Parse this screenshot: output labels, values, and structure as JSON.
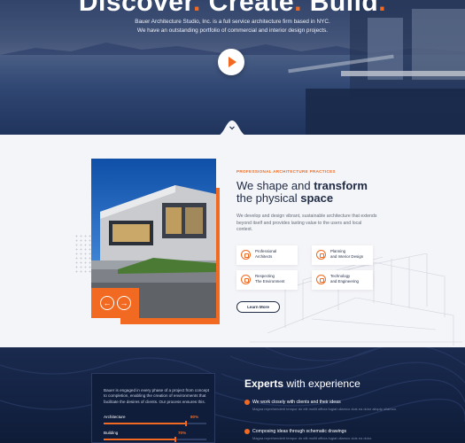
{
  "hero": {
    "title_part1": "Discover",
    "title_part2": "Create",
    "title_part3": "Build",
    "dot": ".",
    "subtitle_line1": "Bauer Architecture Studio, Inc. is a full service architecture firm based in NYC.",
    "subtitle_line2": "We have an outstanding portfolio of commercial and interior design projects.",
    "play_icon": "play-icon",
    "scroll_icon": "chevron-down-icon"
  },
  "about": {
    "eyebrow": "PROFESSIONAL ARCHITECTURE PRACTICES",
    "headline_1": "We shape and ",
    "headline_2": "transform",
    "headline_3": "the physical ",
    "headline_4": "space",
    "body": "We develop and design vibrant, sustainable architecture that extends beyond itself and provides lasting value to the users and local context.",
    "features": [
      {
        "line1": "Professional",
        "line2": "Architects",
        "icon": "architect-icon"
      },
      {
        "line1": "Planning",
        "line2": "and Interior Design",
        "icon": "planning-icon"
      },
      {
        "line1": "Respecting",
        "line2": "The Environment",
        "icon": "leaf-icon"
      },
      {
        "line1": "Technology",
        "line2": "and Engineering",
        "icon": "gear-icon"
      }
    ],
    "learn_more": "Learn More",
    "prev_arrow": "←",
    "next_arrow": "→"
  },
  "experience": {
    "card_text": "Bauer is engaged in every phase of a project from concept to completion, enabling the creation of environments that facilitate the desires of clients. Our process ensures this.",
    "bars": [
      {
        "label": "Architecture",
        "percent": "80%",
        "value": 0.8
      },
      {
        "label": "Building",
        "percent": "70%",
        "value": 0.7
      }
    ],
    "title_1": "Experts",
    "title_2": " with experience",
    "items": [
      {
        "heading": "We work closely with clients and their ideas",
        "sub": "Magna reprehenderit tempor do elit mollit officia fugiat ullamco duis ea dolor aliquip ullamco."
      },
      {
        "heading": "Composing ideas through schematic drawings",
        "sub": "Magna reprehenderit tempor do elit mollit officia fugiat ullamco duis ea dolor."
      }
    ],
    "accent": "#f26a21"
  },
  "colors": {
    "accent": "#f26a21",
    "navy": "#1f2a44",
    "dark_bg": "#132242"
  }
}
